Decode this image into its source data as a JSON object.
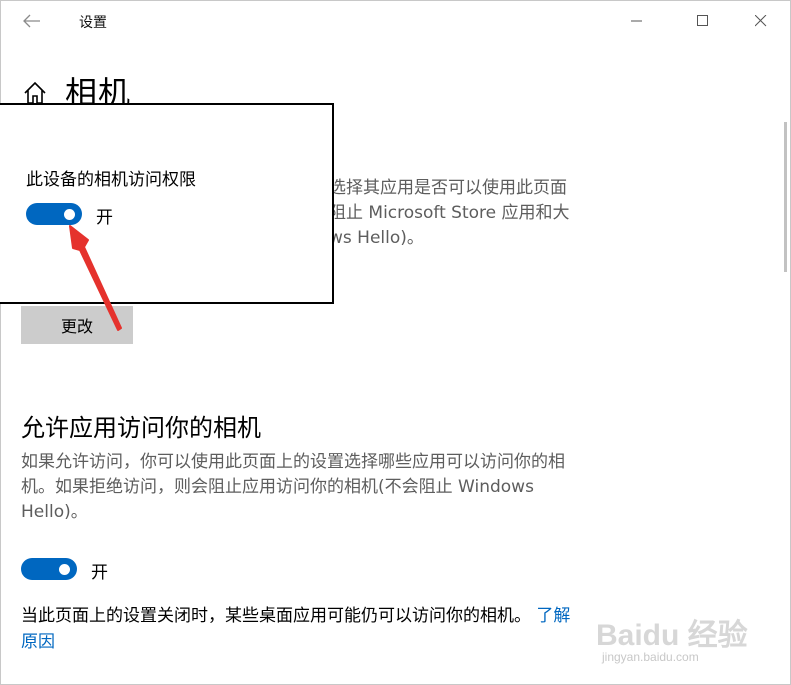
{
  "window": {
    "title": "设置",
    "minimize_icon": "minimize-icon",
    "maximize_icon": "maximize-icon",
    "close_icon": "close-icon",
    "back_icon": "back-arrow-icon"
  },
  "header": {
    "home_icon": "home-icon",
    "title": "相机"
  },
  "device_access": {
    "description": "选择其应用是否可以使用此页面 阻止 Microsoft Store 应用和大 ws Hello)。",
    "change_button": "更改"
  },
  "overlay": {
    "label": "此设备的相机访问权限",
    "toggle_state": "开",
    "toggle_on": true
  },
  "app_access": {
    "title": "允许应用访问你的相机",
    "description": "如果允许访问，你可以使用此页面上的设置选择哪些应用可以访问你的相机。如果拒绝访问，则会阻止应用访问你的相机(不会阻止 Windows Hello)。",
    "toggle_state": "开",
    "toggle_on": true,
    "note": "当此页面上的设置关闭时，某些桌面应用可能仍可以访问你的相机。",
    "learn_link": "了解原因"
  },
  "colors": {
    "accent": "#0067c0",
    "annotation_arrow": "#e5322d"
  },
  "watermark": {
    "logo": "Baidu 经验",
    "url": "jingyan.baidu.com"
  }
}
